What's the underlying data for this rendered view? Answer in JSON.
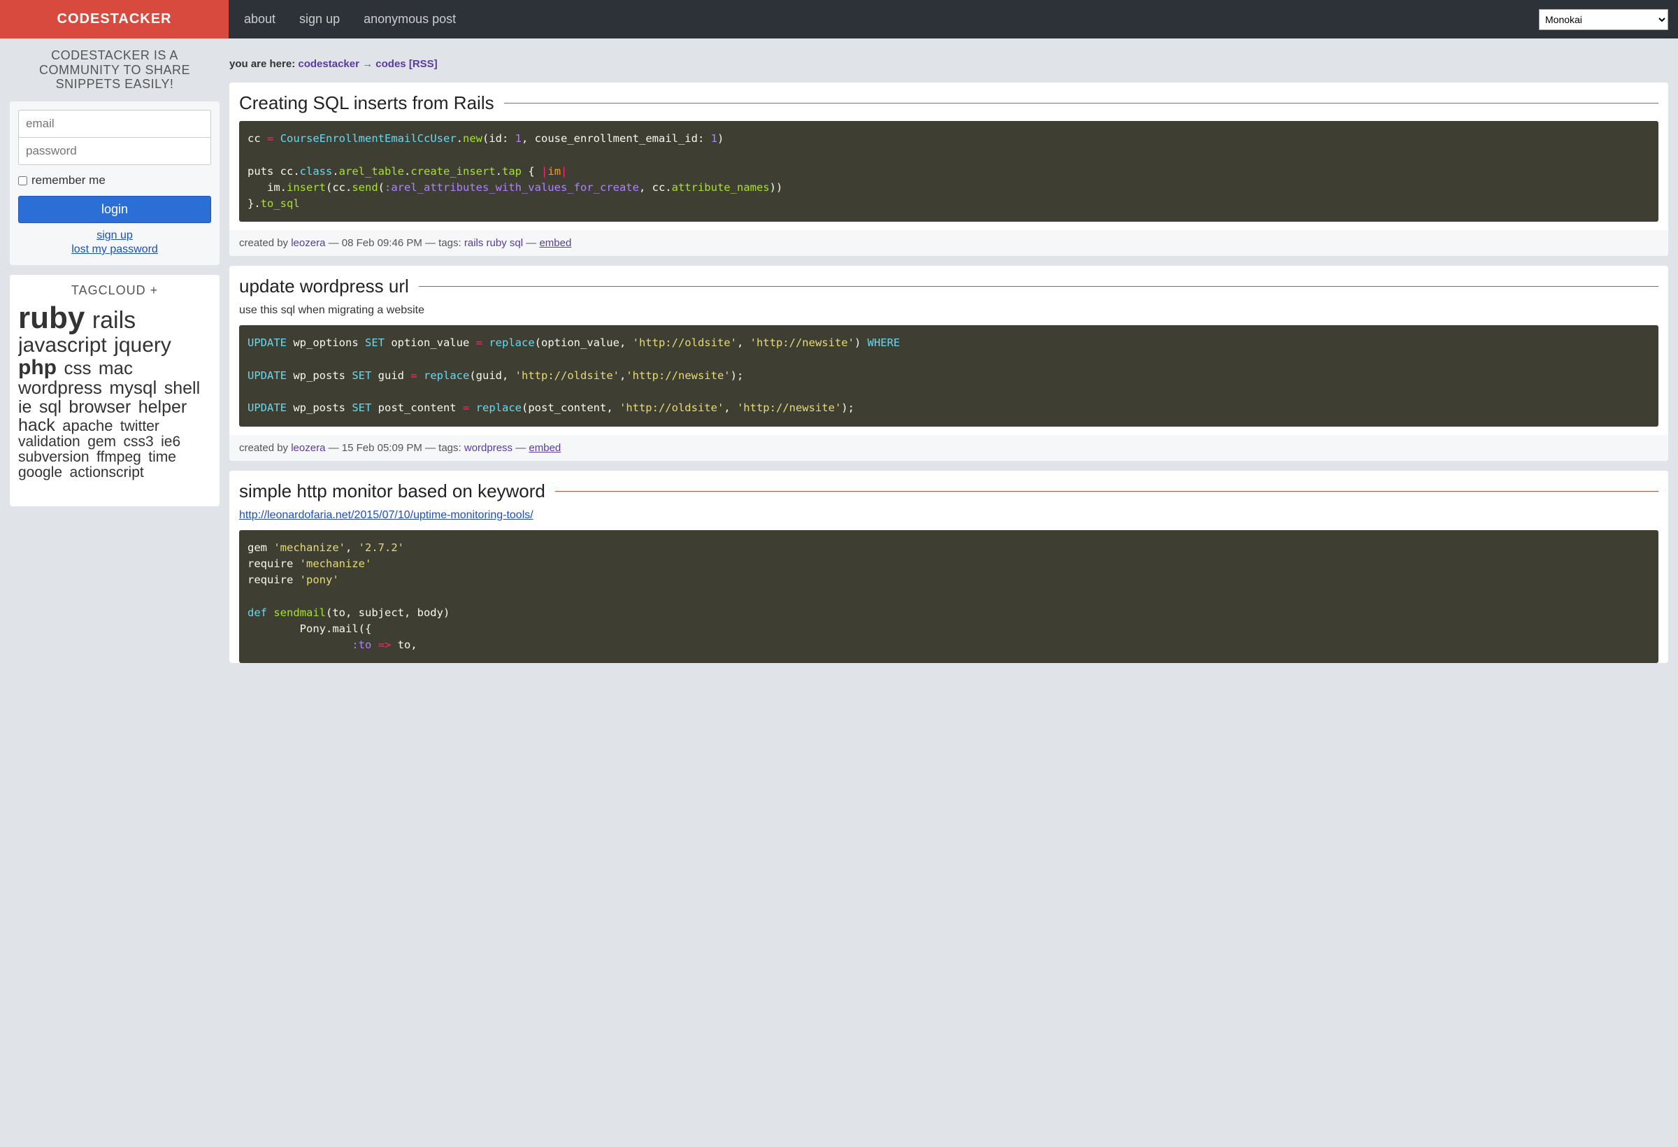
{
  "brand": "CODESTACKER",
  "nav": {
    "about": "about",
    "signup": "sign up",
    "anon": "anonymous post"
  },
  "theme_selected": "Monokai",
  "tagline": "CODESTACKER IS A COMMUNITY TO SHARE SNIPPETS EASILY!",
  "login": {
    "email_ph": "email",
    "password_ph": "password",
    "remember": "remember me",
    "button": "login",
    "signup": "sign up",
    "lost": "lost my password"
  },
  "tagcloud": {
    "title": "TAGCLOUD +",
    "tags": [
      {
        "t": "ruby",
        "s": 44,
        "w": "bold"
      },
      {
        "t": "rails",
        "s": 34,
        "w": "normal"
      },
      {
        "t": "javascript",
        "s": 30,
        "w": "normal"
      },
      {
        "t": "jquery",
        "s": 30,
        "w": "normal"
      },
      {
        "t": "php",
        "s": 30,
        "w": "bold"
      },
      {
        "t": "css",
        "s": 26,
        "w": "normal"
      },
      {
        "t": "mac",
        "s": 26,
        "w": "normal"
      },
      {
        "t": "wordpress",
        "s": 26,
        "w": "normal"
      },
      {
        "t": "mysql",
        "s": 26,
        "w": "normal"
      },
      {
        "t": "shell",
        "s": 25,
        "w": "normal"
      },
      {
        "t": "ie",
        "s": 25,
        "w": "normal"
      },
      {
        "t": "sql",
        "s": 25,
        "w": "normal"
      },
      {
        "t": "browser",
        "s": 25,
        "w": "normal"
      },
      {
        "t": "helper",
        "s": 25,
        "w": "normal"
      },
      {
        "t": "hack",
        "s": 25,
        "w": "normal"
      },
      {
        "t": "apache",
        "s": 22,
        "w": "normal"
      },
      {
        "t": "twitter",
        "s": 21,
        "w": "normal"
      },
      {
        "t": "validation",
        "s": 21,
        "w": "normal"
      },
      {
        "t": "gem",
        "s": 21,
        "w": "normal"
      },
      {
        "t": "css3",
        "s": 21,
        "w": "normal"
      },
      {
        "t": "ie6",
        "s": 21,
        "w": "normal"
      },
      {
        "t": "subversion",
        "s": 21,
        "w": "normal"
      },
      {
        "t": "ffmpeg",
        "s": 21,
        "w": "normal"
      },
      {
        "t": "time",
        "s": 21,
        "w": "normal"
      },
      {
        "t": "google",
        "s": 21,
        "w": "normal"
      },
      {
        "t": "actionscript",
        "s": 21,
        "w": "normal"
      }
    ]
  },
  "breadcrumb": {
    "label": "you are here:",
    "home": "codestacker",
    "arrow": "→",
    "current": "codes",
    "rss": "[RSS]"
  },
  "snippets": [
    {
      "title": "Creating SQL inserts from Rails",
      "desc": "",
      "code_html": "<span class='k-white'>cc </span><span class='k-pink'>=</span><span class='k-white'> </span><span class='k-blue'>CourseEnrollmentEmailCcUser</span><span class='k-white'>.</span><span class='k-green'>new</span><span class='k-white'>(id: </span><span class='k-purple'>1</span><span class='k-white'>, couse_enrollment_email_id: </span><span class='k-purple'>1</span><span class='k-white'>)</span>\n\n<span class='k-white'>puts cc.</span><span class='k-blue'>class</span><span class='k-white'>.</span><span class='k-green'>arel_table</span><span class='k-white'>.</span><span class='k-green'>create_insert</span><span class='k-white'>.</span><span class='k-green'>tap</span><span class='k-white'> { </span><span class='k-pink'>|</span><span class='k-orange'>im</span><span class='k-pink'>|</span>\n<span class='k-white'>   im.</span><span class='k-green'>insert</span><span class='k-white'>(cc.</span><span class='k-green'>send</span><span class='k-white'>(</span><span class='k-purple'>:arel_attributes_with_values_for_create</span><span class='k-white'>, cc.</span><span class='k-green'>attribute_names</span><span class='k-white'>))</span>\n<span class='k-white'>}.</span><span class='k-green'>to_sql</span>",
      "meta": {
        "by_label": "created by",
        "author": "leozera",
        "date": "08 Feb 09:46 PM",
        "tags_label": "tags:",
        "tags": [
          "rails",
          "ruby",
          "sql"
        ],
        "embed": "embed"
      }
    },
    {
      "title": "update wordpress url",
      "desc": "use this sql when migrating a website",
      "code_html": "<span class='k-blue'>UPDATE</span><span class='k-white'> wp_options </span><span class='k-blue'>SET</span><span class='k-white'> option_value </span><span class='k-pink'>=</span><span class='k-white'> </span><span class='k-blue'>replace</span><span class='k-white'>(option_value, </span><span class='k-yellow'>'http://oldsite'</span><span class='k-white'>, </span><span class='k-yellow'>'http://newsite'</span><span class='k-white'>) </span><span class='k-blue'>WHERE</span>\n\n<span class='k-blue'>UPDATE</span><span class='k-white'> wp_posts </span><span class='k-blue'>SET</span><span class='k-white'> guid </span><span class='k-pink'>=</span><span class='k-white'> </span><span class='k-blue'>replace</span><span class='k-white'>(guid, </span><span class='k-yellow'>'http://oldsite'</span><span class='k-white'>,</span><span class='k-yellow'>'http://newsite'</span><span class='k-white'>);</span>\n\n<span class='k-blue'>UPDATE</span><span class='k-white'> wp_posts </span><span class='k-blue'>SET</span><span class='k-white'> post_content </span><span class='k-pink'>=</span><span class='k-white'> </span><span class='k-blue'>replace</span><span class='k-white'>(post_content, </span><span class='k-yellow'>'http://oldsite'</span><span class='k-white'>, </span><span class='k-yellow'>'http://newsite'</span><span class='k-white'>);</span>",
      "meta": {
        "by_label": "created by",
        "author": "leozera",
        "date": "15 Feb 05:09 PM",
        "tags_label": "tags:",
        "tags": [
          "wordpress"
        ],
        "embed": "embed"
      }
    },
    {
      "title": "simple http monitor based on keyword",
      "desc_link": "http://leonardofaria.net/2015/07/10/uptime-monitoring-tools/",
      "code_html": "<span class='k-white'>gem </span><span class='k-yellow'>'mechanize'</span><span class='k-white'>, </span><span class='k-yellow'>'2.7.2'</span>\n<span class='k-white'>require </span><span class='k-yellow'>'mechanize'</span>\n<span class='k-white'>require </span><span class='k-yellow'>'pony'</span>\n\n<span class='k-blue'>def</span><span class='k-white'> </span><span class='k-green'>sendmail</span><span class='k-white'>(to, subject, body)</span>\n<span class='k-white'>        Pony.</span><span class='k-white'>mail({</span>\n<span class='k-white'>                </span><span class='k-purple'>:to</span><span class='k-white'> </span><span class='k-pink'>=&gt;</span><span class='k-white'> to,</span>",
      "meta": null
    }
  ]
}
